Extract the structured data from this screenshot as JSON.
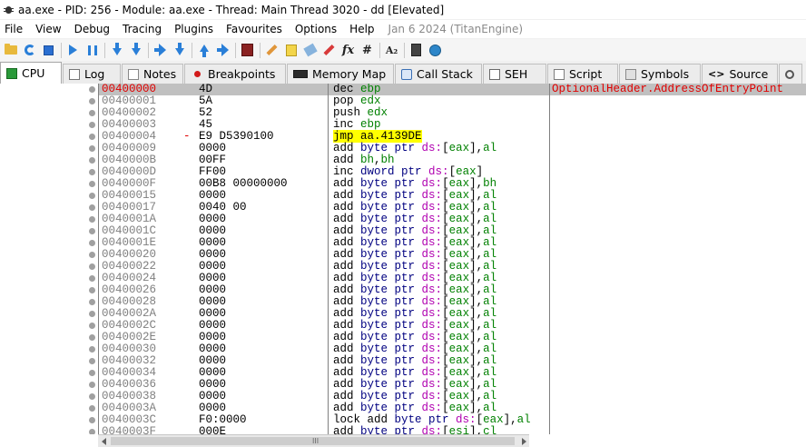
{
  "window": {
    "title": "aa.exe - PID: 256 - Module: aa.exe - Thread: Main Thread 3020 - dd [Elevated]"
  },
  "menu": {
    "items": [
      "File",
      "View",
      "Debug",
      "Tracing",
      "Plugins",
      "Favourites",
      "Options",
      "Help"
    ],
    "build_date": "Jan 6 2024 (TitanEngine)"
  },
  "toolbar": {
    "icons": [
      "open-icon",
      "restart-icon",
      "stop-icon",
      "run-icon",
      "pause-icon",
      "step-into-icon",
      "step-over-icon",
      "trace-icon",
      "run-to-user-icon",
      "execute-till-return-icon",
      "scylla-icon",
      "patch-icon",
      "comment-icon",
      "label-icon",
      "bookmark-icon",
      "function-icon",
      "hash-icon",
      "font-icon",
      "calculator-icon",
      "globe-icon"
    ],
    "labels": {
      "fx": "fx",
      "hash": "#",
      "font": "A₂"
    }
  },
  "tabs": [
    {
      "label": "CPU",
      "active": true
    },
    {
      "label": "Log"
    },
    {
      "label": "Notes"
    },
    {
      "label": "Breakpoints"
    },
    {
      "label": "Memory Map"
    },
    {
      "label": "Call Stack"
    },
    {
      "label": "SEH"
    },
    {
      "label": "Script"
    },
    {
      "label": "Symbols"
    },
    {
      "label": "Source"
    }
  ],
  "source_tab_icon": "<>",
  "disasm": {
    "rows": [
      {
        "addr": "00400000",
        "bytes": "4D",
        "ins": "dec ebp",
        "comment": "OptionalHeader.AddressOfEntryPoint",
        "current": true
      },
      {
        "addr": "00400001",
        "bytes": "5A",
        "ins": "pop edx"
      },
      {
        "addr": "00400002",
        "bytes": "52",
        "ins": "push edx"
      },
      {
        "addr": "00400003",
        "bytes": "45",
        "ins": "inc ebp"
      },
      {
        "addr": "00400004",
        "bytes": "E9 D5390100",
        "ins": "jmp aa.4139DE",
        "arrow": "-",
        "jmp": true
      },
      {
        "addr": "00400009",
        "bytes": "0000",
        "ins": "add byte ptr ds:[eax],al"
      },
      {
        "addr": "0040000B",
        "bytes": "00FF",
        "ins": "add bh,bh"
      },
      {
        "addr": "0040000D",
        "bytes": "FF00",
        "ins": "inc dword ptr ds:[eax]"
      },
      {
        "addr": "0040000F",
        "bytes": "00B8 00000000",
        "ins": "add byte ptr ds:[eax],bh"
      },
      {
        "addr": "00400015",
        "bytes": "0000",
        "ins": "add byte ptr ds:[eax],al"
      },
      {
        "addr": "00400017",
        "bytes": "0040 00",
        "ins": "add byte ptr ds:[eax],al"
      },
      {
        "addr": "0040001A",
        "bytes": "0000",
        "ins": "add byte ptr ds:[eax],al"
      },
      {
        "addr": "0040001C",
        "bytes": "0000",
        "ins": "add byte ptr ds:[eax],al"
      },
      {
        "addr": "0040001E",
        "bytes": "0000",
        "ins": "add byte ptr ds:[eax],al"
      },
      {
        "addr": "00400020",
        "bytes": "0000",
        "ins": "add byte ptr ds:[eax],al"
      },
      {
        "addr": "00400022",
        "bytes": "0000",
        "ins": "add byte ptr ds:[eax],al"
      },
      {
        "addr": "00400024",
        "bytes": "0000",
        "ins": "add byte ptr ds:[eax],al"
      },
      {
        "addr": "00400026",
        "bytes": "0000",
        "ins": "add byte ptr ds:[eax],al"
      },
      {
        "addr": "00400028",
        "bytes": "0000",
        "ins": "add byte ptr ds:[eax],al"
      },
      {
        "addr": "0040002A",
        "bytes": "0000",
        "ins": "add byte ptr ds:[eax],al"
      },
      {
        "addr": "0040002C",
        "bytes": "0000",
        "ins": "add byte ptr ds:[eax],al"
      },
      {
        "addr": "0040002E",
        "bytes": "0000",
        "ins": "add byte ptr ds:[eax],al"
      },
      {
        "addr": "00400030",
        "bytes": "0000",
        "ins": "add byte ptr ds:[eax],al"
      },
      {
        "addr": "00400032",
        "bytes": "0000",
        "ins": "add byte ptr ds:[eax],al"
      },
      {
        "addr": "00400034",
        "bytes": "0000",
        "ins": "add byte ptr ds:[eax],al"
      },
      {
        "addr": "00400036",
        "bytes": "0000",
        "ins": "add byte ptr ds:[eax],al"
      },
      {
        "addr": "00400038",
        "bytes": "0000",
        "ins": "add byte ptr ds:[eax],al"
      },
      {
        "addr": "0040003A",
        "bytes": "0000",
        "ins": "add byte ptr ds:[eax],al"
      },
      {
        "addr": "0040003C",
        "bytes": "F0:0000",
        "ins": "lock add byte ptr ds:[eax],al"
      },
      {
        "addr": "0040003F",
        "bytes": "000E",
        "ins": "add byte ptr ds:[esi],cl"
      }
    ]
  },
  "scrollbar": {
    "grip": "III"
  },
  "colors": {
    "current_address": "#e00000",
    "register": "#008000",
    "segment": "#b000b0",
    "jump_highlight": "#ffff00",
    "selected_row": "#c0c0c0"
  }
}
